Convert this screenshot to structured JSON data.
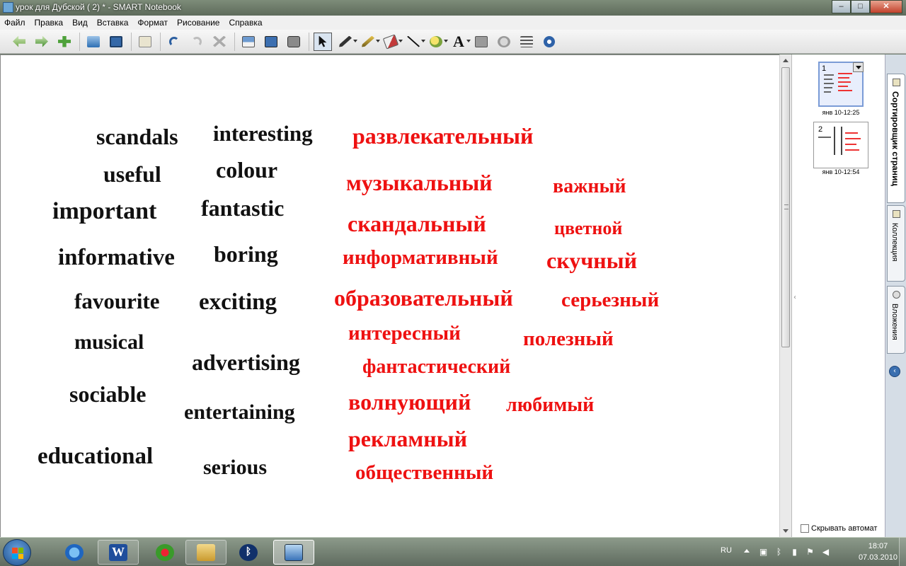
{
  "window": {
    "title": "урок для Дубской ( 2) * - SMART Notebook",
    "minimize": "–",
    "maximize": "□",
    "close": "✕"
  },
  "menu": [
    "Файл",
    "Правка",
    "Вид",
    "Вставка",
    "Формат",
    "Рисование",
    "Справка"
  ],
  "toolbar": {
    "buttons": [
      "back-icon",
      "forward-icon",
      "add-page-icon",
      "open-icon",
      "save-icon",
      "paste-icon",
      "undo-icon",
      "redo-icon",
      "delete-icon",
      "screen-shade-icon",
      "fullscreen-icon",
      "screen-capture-icon",
      "select-icon",
      "pen-icon",
      "creative-pen-icon",
      "eraser-icon",
      "line-icon",
      "shapes-icon",
      "text-icon",
      "table-icon",
      "properties-icon",
      "toolbar-settings-icon",
      "move-toolbar-icon"
    ],
    "text_tool_label": "A"
  },
  "words_en": [
    "scandals",
    "interesting",
    "useful",
    "colour",
    "important",
    "fantastic",
    "informative",
    "boring",
    "favourite",
    "exciting",
    "musical",
    "advertising",
    "sociable",
    "entertaining",
    "educational",
    "serious"
  ],
  "words_ru": [
    "развлекательный",
    "музыкальный",
    "важный",
    "скандальный",
    "цветной",
    "информативный",
    "скучный",
    "образовательный",
    "серьезный",
    "интересный",
    "полезный",
    "фантастический",
    "волнующий",
    "любимый",
    "рекламный",
    "общественный"
  ],
  "page_sorter": {
    "pages": [
      {
        "number": "1",
        "caption": "янв 10-12:25"
      },
      {
        "number": "2",
        "caption": "янв 10-12:54"
      }
    ],
    "autohide_label": "Скрывать автомат"
  },
  "side_tabs": [
    "Сортировщик страниц",
    "Коллекция",
    "Вложения"
  ],
  "taskbar": {
    "language": "RU",
    "time": "18:07",
    "date": "07.03.2010",
    "word_icon_letter": "W"
  },
  "colors": {
    "english_text": "#111111",
    "russian_text": "#ee1111",
    "canvas": "#ffffff"
  }
}
